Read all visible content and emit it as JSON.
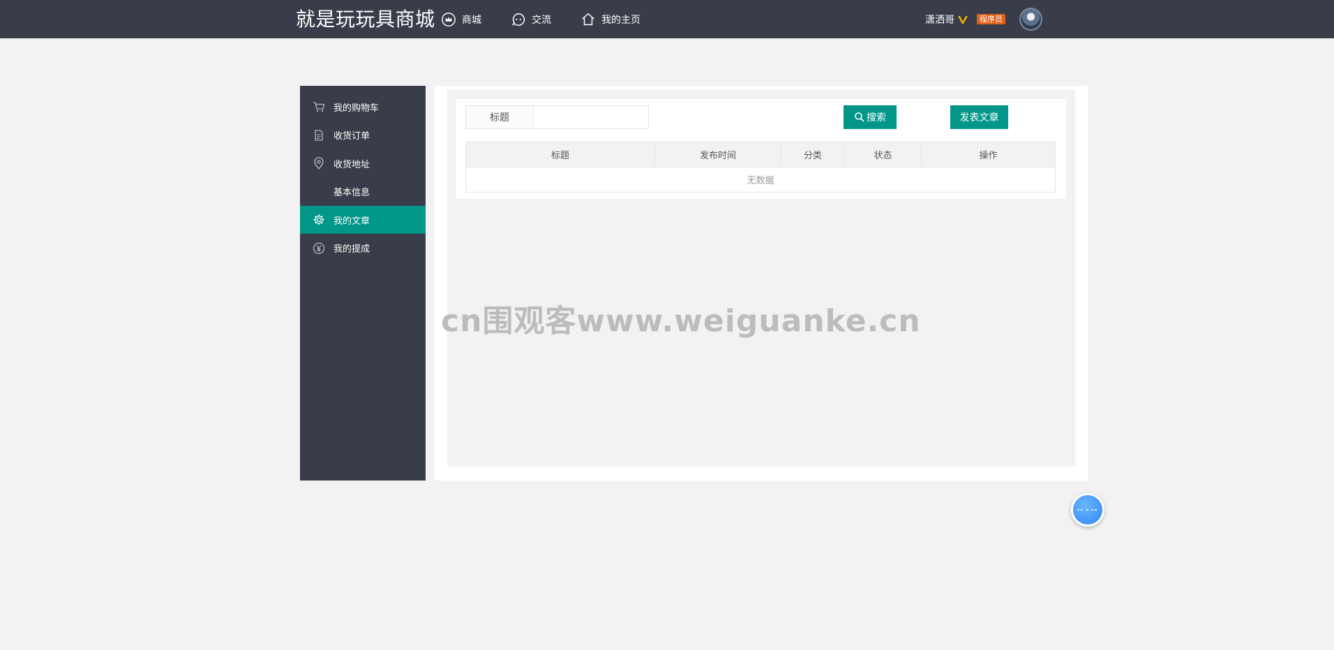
{
  "header": {
    "logo": "就是玩玩具商城",
    "nav": [
      {
        "label": "商城",
        "icon": "crown-icon"
      },
      {
        "label": "交流",
        "icon": "chat-icon"
      },
      {
        "label": "我的主页",
        "icon": "home-icon"
      }
    ],
    "user": {
      "name": "潇洒哥",
      "badge": "程序员"
    }
  },
  "sidebar": {
    "items": [
      {
        "label": "我的购物车",
        "icon": "cart-icon"
      },
      {
        "label": "收货订单",
        "icon": "document-icon"
      },
      {
        "label": "收货地址",
        "icon": "location-icon"
      },
      {
        "label": "基本信息",
        "icon": ""
      },
      {
        "label": "我的文章",
        "icon": "gear-icon",
        "active": true
      },
      {
        "label": "我的提成",
        "icon": "yen-icon"
      }
    ]
  },
  "search": {
    "label": "标题",
    "value": "",
    "search_button": "搜索",
    "post_button": "发表文章"
  },
  "table": {
    "columns": [
      "标题",
      "发布时间",
      "分类",
      "状态",
      "操作"
    ],
    "empty_text": "无数据"
  },
  "watermark": "cn围观客www.weiguanke.cn",
  "colors": {
    "header_bg": "#393d49",
    "accent": "#009688",
    "badge": "#e2611a"
  }
}
